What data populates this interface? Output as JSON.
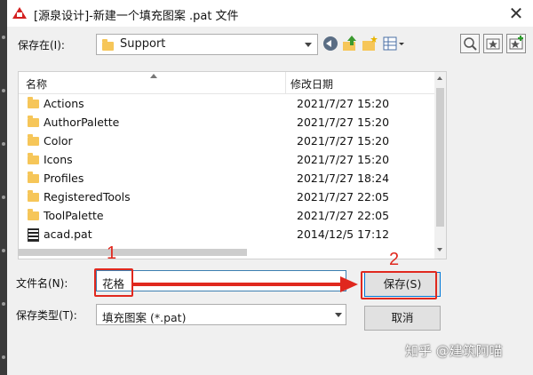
{
  "window": {
    "title": "[源泉设计]-新建一个填充图案 .pat 文件",
    "close_glyph": "✕"
  },
  "look_in": {
    "label": "保存在(I):",
    "value": "Support"
  },
  "file_list": {
    "columns": [
      "名称",
      "修改日期"
    ],
    "rows": [
      {
        "name": "Actions",
        "date": "2021/7/27 15:20",
        "type": "folder"
      },
      {
        "name": "AuthorPalette",
        "date": "2021/7/27 15:20",
        "type": "folder"
      },
      {
        "name": "Color",
        "date": "2021/7/27 15:20",
        "type": "folder"
      },
      {
        "name": "Icons",
        "date": "2021/7/27 15:20",
        "type": "folder"
      },
      {
        "name": "Profiles",
        "date": "2021/7/27 18:24",
        "type": "folder"
      },
      {
        "name": "RegisteredTools",
        "date": "2021/7/27 22:05",
        "type": "folder"
      },
      {
        "name": "ToolPalette",
        "date": "2021/7/27 22:05",
        "type": "folder"
      },
      {
        "name": "acad.pat",
        "date": "2014/12/5 17:12",
        "type": "file"
      }
    ]
  },
  "file_name": {
    "label": "文件名(N):",
    "value": "花格"
  },
  "file_type": {
    "label": "保存类型(T):",
    "value": "填充图案 (*.pat)"
  },
  "buttons": {
    "save": "保存(S)",
    "cancel": "取消"
  },
  "annotations": {
    "step1": "1",
    "step2": "2"
  },
  "watermark": "知乎 @建筑阿喵",
  "colors": {
    "annotation_red": "#e0281e",
    "folder_yellow": "#f6c659",
    "focus_blue": "#0078d7"
  }
}
